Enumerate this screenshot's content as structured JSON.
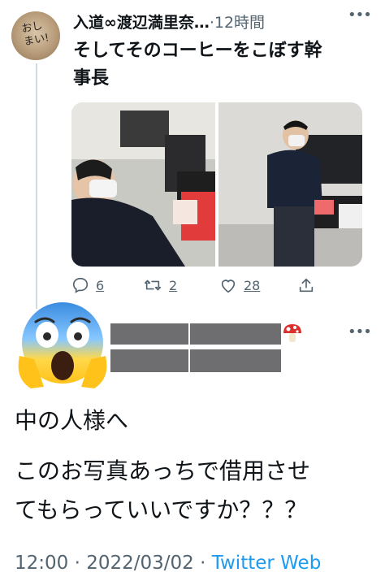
{
  "reply_to_tweet": {
    "avatar_text": "おし\nまい!",
    "display_name": "入道∞渡辺満里奈…",
    "separator": "·",
    "time": "12時間",
    "text_line1": "そしてそのコーヒーをこぼす幹",
    "text_line2": "事長",
    "more_icon": "more-horizontal-icon",
    "actions": {
      "reply_count": "6",
      "retweet_count": "2",
      "like_count": "28"
    }
  },
  "main_tweet": {
    "emoji": "face-screaming-in-fear",
    "mushroom_emoji": "mushroom",
    "more_icon": "more-horizontal-icon",
    "text_line1": "中の人様へ",
    "text_line2": "このお写真あっちで借用させ",
    "text_line3": "てもらっていいですか？？？",
    "time": "12:00",
    "date": "2022/03/02",
    "separator": "·",
    "source": "Twitter Web"
  }
}
